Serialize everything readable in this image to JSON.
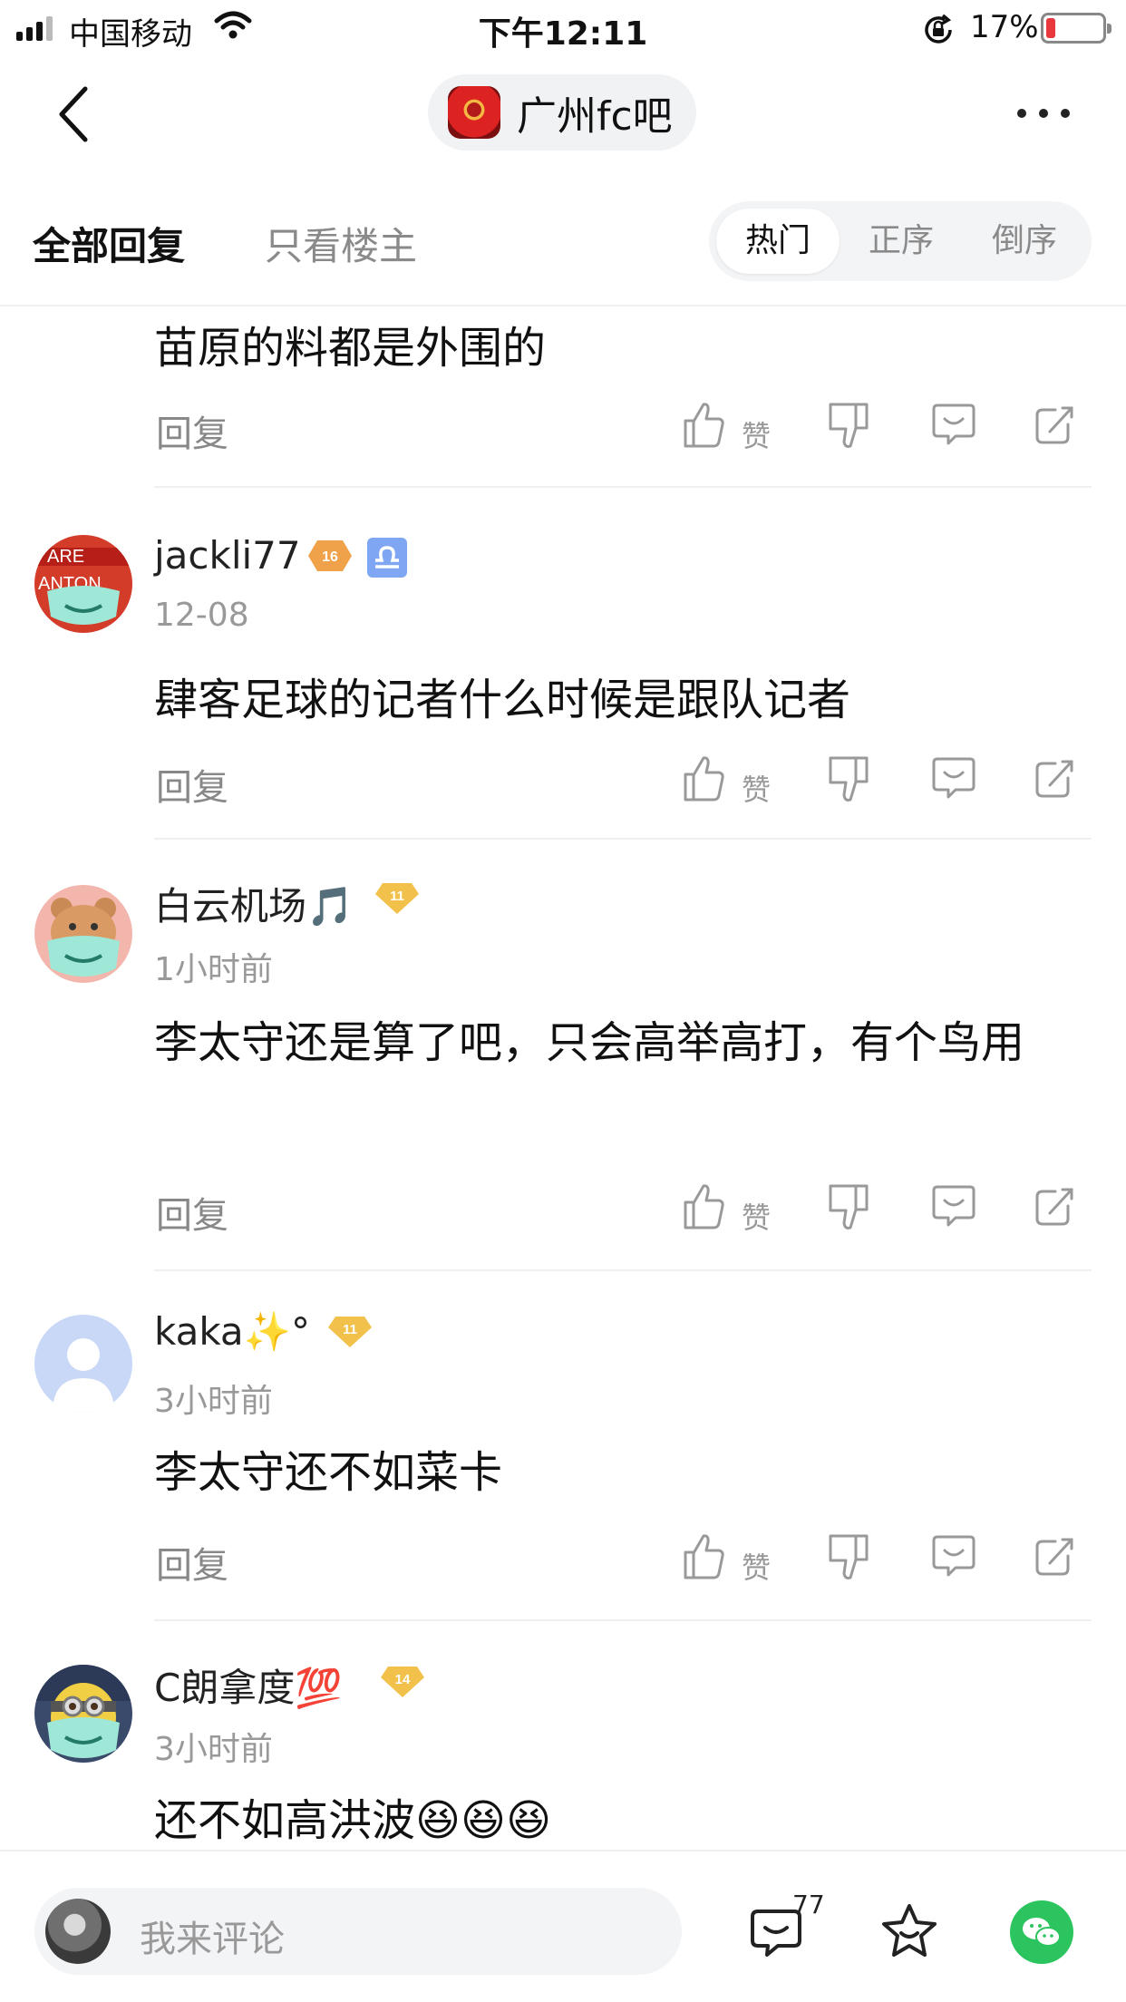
{
  "status_bar": {
    "carrier": "中国移动",
    "time": "下午12:11",
    "battery_percent": "17%",
    "battery_level": 0.17
  },
  "nav": {
    "forum_name": "广州fc吧"
  },
  "filters": {
    "tab_all": "全部回复",
    "tab_op_only": "只看楼主",
    "sort_hot": "热门",
    "sort_asc": "正序",
    "sort_desc": "倒序",
    "active_sort": "热门"
  },
  "comments": [
    {
      "content": "苗原的料都是外围的",
      "reply_label": "回复",
      "like_label": "赞"
    },
    {
      "username": "jackli77",
      "level": "16",
      "time": "12-08",
      "content": "肆客足球的记者什么时候是跟队记者",
      "reply_label": "回复",
      "like_label": "赞"
    },
    {
      "username": "白云机场🎵",
      "level": "11",
      "time": "1小时前",
      "content": "李太守还是算了吧，只会高举高打，有个鸟用",
      "reply_label": "回复",
      "like_label": "赞"
    },
    {
      "username": "kaka✨°",
      "level": "11",
      "time": "3小时前",
      "content": "李太守还不如菜卡",
      "reply_label": "回复",
      "like_label": "赞"
    },
    {
      "username": "C朗拿度💯",
      "level": "14",
      "time": "3小时前",
      "content": "还不如高洪波😆😆😆"
    }
  ],
  "bottom_bar": {
    "placeholder": "我来评论",
    "comment_count": "77"
  },
  "colors": {
    "accent_green": "#2bc45f",
    "badge_orange": "#f0a24a",
    "badge_gold": "#f2c14b",
    "libra_blue": "#7ea6f2",
    "battery_red": "#e8383d"
  },
  "icons": [
    "back-icon",
    "more-icon",
    "like-icon",
    "dislike-icon",
    "comment-icon",
    "share-icon",
    "star-icon",
    "wechat-icon",
    "libra-icon"
  ]
}
